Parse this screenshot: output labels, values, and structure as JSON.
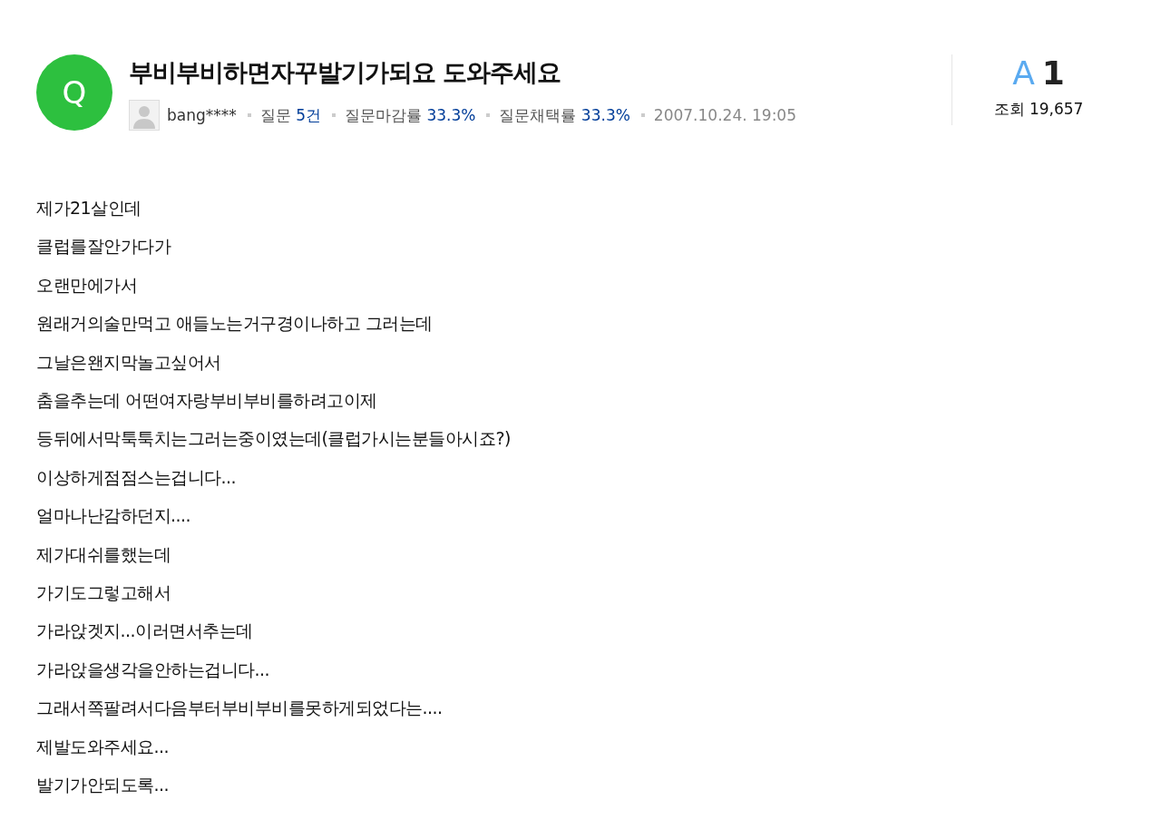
{
  "question": {
    "badge": "Q",
    "title": "부비부비하면자꾸발기가되요 도와주세요",
    "author": "bang****",
    "stats": [
      {
        "label": "질문",
        "value": "5건"
      },
      {
        "label": "질문마감률",
        "value": "33.3%"
      },
      {
        "label": "질문채택률",
        "value": "33.3%"
      }
    ],
    "date": "2007.10.24. 19:05"
  },
  "answers": {
    "letter": "A",
    "count": "1",
    "views_label": "조회",
    "views": "19,657"
  },
  "body": [
    "제가21살인데",
    "클럽를잘안가다가",
    "오랜만에가서",
    "원래거의술만먹고 애들노는거구경이나하고 그러는데",
    "그날은왠지막놀고싶어서",
    "춤을추는데 어떤여자랑부비부비를하려고이제",
    "등뒤에서막툭툭치는그러는중이였는데(클럽가시는분들아시죠?)",
    "이상하게점점스는겁니다...",
    "얼마나난감하던지....",
    "제가대쉬를했는데",
    "가기도그렇고해서",
    "가라앉겟지...이러면서추는데",
    "가라앉을생각을안하는겁니다...",
    "그래서쪽팔려서다음부터부비부비를못하게되었다는....",
    "제발도와주세요...",
    "발기가안되도록..."
  ]
}
